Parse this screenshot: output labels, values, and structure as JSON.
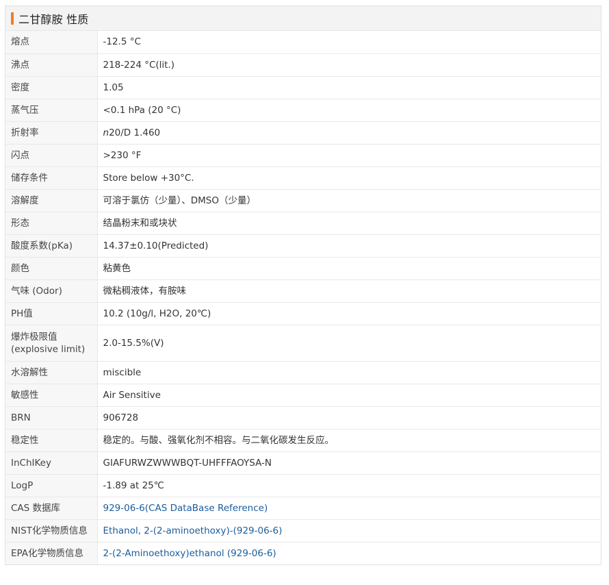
{
  "section": {
    "title": "二甘醇胺 性质",
    "accent_color": "#f47c20"
  },
  "rows": [
    {
      "label": "熔点",
      "value": "-12.5 °C"
    },
    {
      "label": "沸点",
      "value": "218-224 °C(lit.)"
    },
    {
      "label": "密度",
      "value": "1.05"
    },
    {
      "label": "蒸气压",
      "value": "<0.1 hPa (20 °C)"
    },
    {
      "label": "折射率",
      "value_prefix": "n",
      "value": "20/D 1.460"
    },
    {
      "label": "闪点",
      "value": ">230 °F"
    },
    {
      "label": "储存条件",
      "value": "Store below +30°C."
    },
    {
      "label": "溶解度",
      "value": "可溶于氯仿（少量）、DMSO（少量）"
    },
    {
      "label": "形态",
      "value": "结晶粉末和或块状"
    },
    {
      "label": "酸度系数(pKa)",
      "value": "14.37±0.10(Predicted)"
    },
    {
      "label": "颜色",
      "value": "粘黄色"
    },
    {
      "label": "气味 (Odor)",
      "value": "微粘稠液体，有胺味"
    },
    {
      "label": "PH值",
      "value": "10.2 (10g/l, H2O, 20℃)"
    },
    {
      "label": "爆炸极限值(explosive limit)",
      "value": "2.0-15.5%(V)"
    },
    {
      "label": "水溶解性",
      "value": "miscible"
    },
    {
      "label": "敏感性",
      "value": "Air Sensitive"
    },
    {
      "label": "BRN",
      "value": "906728"
    },
    {
      "label": "稳定性",
      "value": "稳定的。与酸、强氧化剂不相容。与二氧化碳发生反应。"
    },
    {
      "label": "InChIKey",
      "value": "GIAFURWZWWWBQT-UHFFFAOYSA-N"
    },
    {
      "label": "LogP",
      "value": "-1.89 at 25℃"
    },
    {
      "label": "CAS 数据库",
      "value": "929-06-6(CAS DataBase Reference)",
      "link": true
    },
    {
      "label": "NIST化学物质信息",
      "value": "Ethanol, 2-(2-aminoethoxy)-(929-06-6)",
      "link": true
    },
    {
      "label": "EPA化学物质信息",
      "value": "2-(2-Aminoethoxy)ethanol (929-06-6)",
      "link": true
    }
  ],
  "link_color": "#1a5d9c"
}
